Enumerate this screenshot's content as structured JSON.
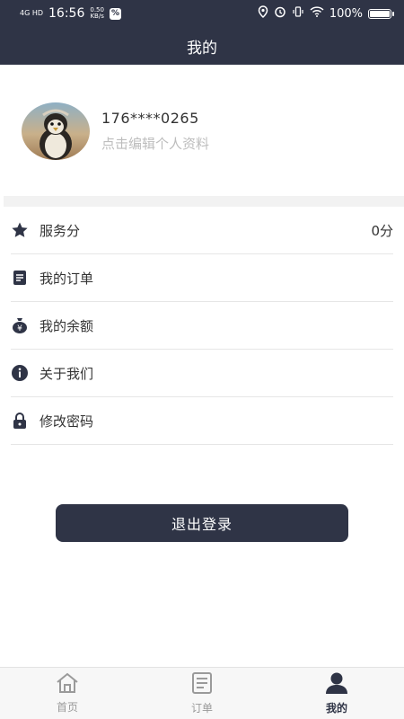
{
  "status_bar": {
    "network": "4G HD",
    "time": "16:56",
    "speed_value": "0.50",
    "speed_unit": "KB/s",
    "badge": "%",
    "battery": "100%"
  },
  "header": {
    "title": "我的"
  },
  "profile": {
    "phone": "176****0265",
    "edit_hint": "点击编辑个人资料"
  },
  "menu": [
    {
      "label": "服务分",
      "value": "0分",
      "icon": "star-icon"
    },
    {
      "label": "我的订单",
      "value": "",
      "icon": "document-icon"
    },
    {
      "label": "我的余额",
      "value": "",
      "icon": "money-bag-icon"
    },
    {
      "label": "关于我们",
      "value": "",
      "icon": "info-icon"
    },
    {
      "label": "修改密码",
      "value": "",
      "icon": "lock-icon"
    }
  ],
  "logout": {
    "label": "退出登录"
  },
  "tabbar": {
    "tabs": [
      {
        "label": "首页",
        "icon": "home-icon"
      },
      {
        "label": "订单",
        "icon": "order-icon"
      },
      {
        "label": "我的",
        "icon": "user-icon",
        "active": true
      }
    ]
  },
  "colors": {
    "primary": "#2f3446",
    "muted": "#bdbdbd",
    "divider": "#e6e6e6"
  }
}
